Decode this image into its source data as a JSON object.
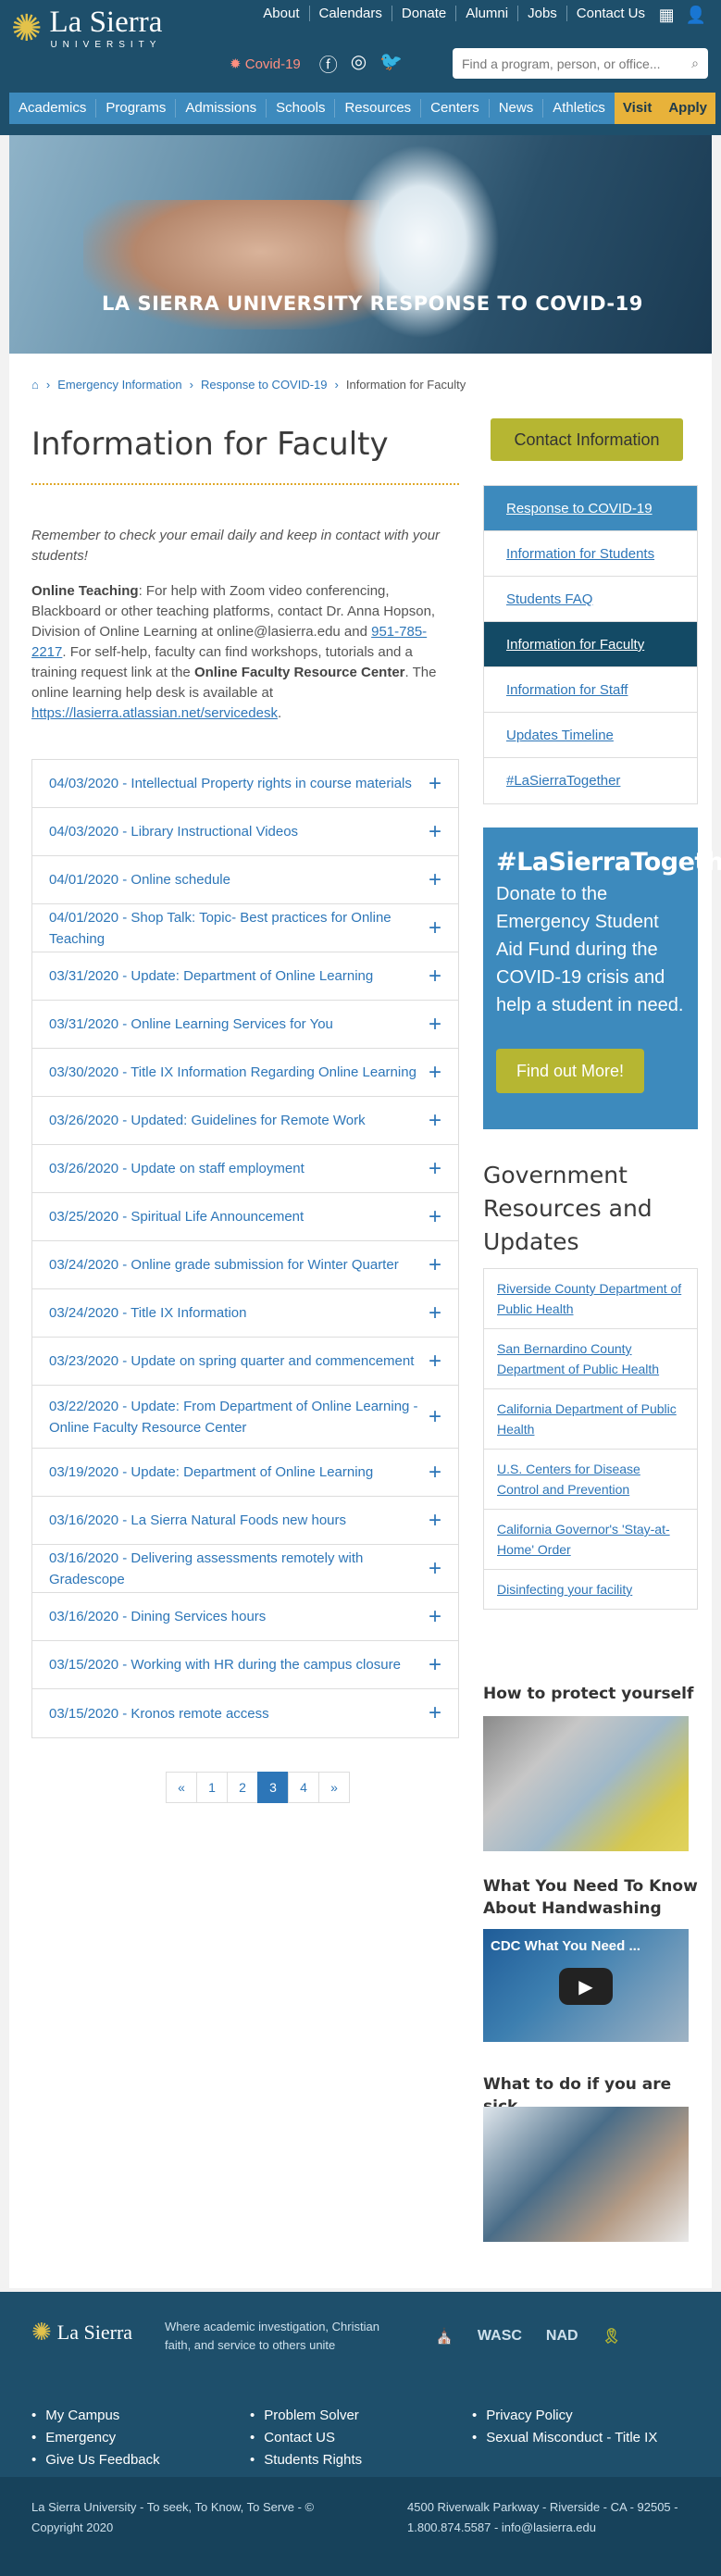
{
  "header": {
    "logo_name": "La Sierra",
    "logo_sub": "UNIVERSITY",
    "links": [
      "About",
      "Calendars",
      "Donate",
      "Alumni",
      "Jobs",
      "Contact Us"
    ],
    "covid": "Covid-19",
    "search_placeholder": "Find a program, person, or office..."
  },
  "nav": {
    "items": [
      "Academics",
      "Programs",
      "Admissions",
      "Schools",
      "Resources",
      "Centers",
      "News",
      "Athletics"
    ],
    "visit": "Visit",
    "apply": "Apply"
  },
  "hero": {
    "title": "LA SIERRA UNIVERSITY RESPONSE TO COVID-19"
  },
  "breadcrumb": [
    "Emergency Information",
    "Response to COVID-19",
    "Information for Faculty"
  ],
  "page": {
    "title": "Information for Faculty",
    "note": "Remember to check your email daily and keep in contact with your students!",
    "ot_label": "Online Teaching",
    "ot_1": ": For help with Zoom video conferencing, Blackboard or other teaching platforms, contact Dr. Anna Hopson, Division of Online Learning at online@lasierra.edu and ",
    "ot_phone": "951-785-2217",
    "ot_2": ". For self-help, faculty can find workshops, tutorials and a training request link at the ",
    "ot_center": "Online Faculty Resource Center",
    "ot_3": ". The online learning help desk is available at ",
    "ot_link": "https://lasierra.atlassian.net/servicedesk",
    "ot_4": "."
  },
  "accordion": [
    "04/03/2020 - Intellectual Property rights in course materials",
    "04/03/2020 - Library Instructional Videos",
    "04/01/2020 - Online schedule",
    "04/01/2020 - Shop Talk: Topic- Best practices for Online Teaching",
    "03/31/2020 - Update: Department of Online Learning",
    "03/31/2020 - Online Learning Services for You",
    "03/30/2020 - Title IX Information Regarding Online Learning",
    "03/26/2020 - Updated: Guidelines for Remote Work",
    "03/26/2020 - Update on staff employment",
    "03/25/2020 - Spiritual Life Announcement",
    "03/24/2020 - Online grade submission for Winter Quarter",
    "03/24/2020 - Title IX Information",
    "03/23/2020 - Update on spring quarter and commencement",
    "03/22/2020 - Update: From Department of Online Learning - Online Faculty Resource Center",
    "03/19/2020 - Update: Department of Online Learning",
    "03/16/2020 - La Sierra Natural Foods new hours",
    "03/16/2020 - Delivering assessments remotely with Gradescope",
    "03/16/2020 - Dining Services hours",
    "03/15/2020 - Working with HR during the campus closure",
    "03/15/2020 - Kronos remote access"
  ],
  "pager": [
    "«",
    "1",
    "2",
    "3",
    "4",
    "»"
  ],
  "sidebar": {
    "contact": "Contact Information",
    "nav": [
      "Response to COVID-19",
      "Information for Students",
      "Students FAQ",
      "Information for Faculty",
      "Information for Staff",
      "Updates Timeline",
      "#LaSierraTogether"
    ],
    "tog_head": "#LaSierraTogether",
    "tog_text": "Donate to the Emergency Student Aid Fund during the COVID-19 crisis and help a student in need.",
    "tog_btn": "Find out More!",
    "gov_head": "Government Resources and Updates",
    "gov": [
      "Riverside County Department of Public Health",
      "San Bernardino County Department of Public Health",
      "California Department of Public Health",
      "U.S. Centers for Disease Control and Prevention",
      "California Governor's 'Stay-at-Home' Order",
      "Disinfecting your facility"
    ],
    "protect": "How to protect yourself",
    "handwash": "What You Need To Know About Handwashing",
    "video_title": "What You Need ...",
    "video_logo": "CDC",
    "sick": "What to do if you are sick"
  },
  "footer": {
    "name": "La Sierra",
    "tagline": "Where academic investigation, Christian faith, and service to others unite",
    "marks": [
      "WASC",
      "NAD"
    ],
    "col1": [
      "My Campus",
      "Emergency",
      "Give Us Feedback"
    ],
    "col2": [
      "Problem Solver",
      "Contact US",
      "Students Rights"
    ],
    "col3": [
      "Privacy Policy",
      "Sexual Misconduct - Title IX"
    ],
    "motto": "La Sierra University - To seek, To Know, To Serve - © Copyright 2020",
    "address": "4500 Riverwalk Parkway - Riverside - CA - 92505 -",
    "contact": "1.800.874.5587 - info@lasierra.edu"
  }
}
